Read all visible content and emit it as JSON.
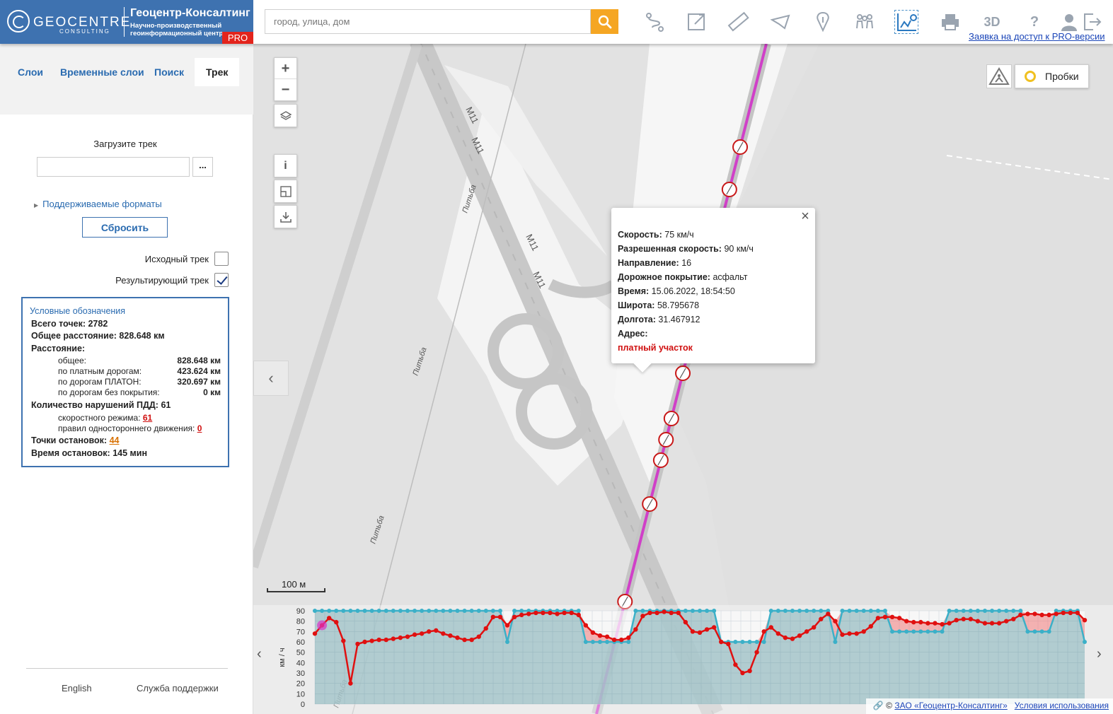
{
  "header": {
    "logo": {
      "brand": "GEOCENTRE",
      "brand_sub": "CONSULTING",
      "title_ru": "Геоцентр-Консалтинг",
      "subtitle_ru_1": "Научно-производственный",
      "subtitle_ru_2": "геоинформационный центр",
      "badge": "PRO"
    },
    "search": {
      "placeholder": "город, улица, дом",
      "value": ""
    },
    "toolbar": {
      "icons": [
        "route-icon",
        "export-icon",
        "ruler-icon",
        "area-icon",
        "info-pin-icon",
        "people-icon",
        "track-chart-icon",
        "print-icon",
        "3d-icon",
        "help-icon",
        "user-icon",
        "logout-icon"
      ],
      "label_3d": "3D",
      "label_help": "?"
    },
    "pro_link": "Заявка на доступ к PRO-версии"
  },
  "sidebar": {
    "tabs": [
      {
        "label": "Слои"
      },
      {
        "label": "Временные слои"
      },
      {
        "label": "Поиск"
      },
      {
        "label": "Трек"
      }
    ],
    "active_tab": "Трек",
    "upload": {
      "title": "Загрузите трек",
      "value": "",
      "browse_label": "..."
    },
    "formats_link": "Поддерживаемые форматы",
    "reset_button": "Сбросить",
    "checkboxes": [
      {
        "label": "Исходный трек",
        "checked": false
      },
      {
        "label": "Результирующий трек",
        "checked": true
      }
    ],
    "legend": {
      "title": "Условные обозначения",
      "total_points_label": "Всего точек:",
      "total_points": "2782",
      "total_distance_label": "Общее расстояние:",
      "total_distance": "828.648 км",
      "distance_label": "Расстояние:",
      "distances": [
        {
          "label": "общее:",
          "value": "828.648 км"
        },
        {
          "label": "по платным дорогам:",
          "value": "423.624 км"
        },
        {
          "label": "по дорогам ПЛАТОН:",
          "value": "320.697 км"
        },
        {
          "label": "по дорогам без покрытия:",
          "value": "0 км"
        }
      ],
      "violations_label": "Количество нарушений ПДД:",
      "violations": "61",
      "speed_violations_label": "скоростного режима:",
      "speed_violations": "61",
      "oneway_violations_label": "правил одностороннего движения:",
      "oneway_violations": "0",
      "stops_label": "Точки остановок:",
      "stops": "44",
      "stop_time_label": "Время остановок:",
      "stop_time": "145 мин"
    },
    "footer": {
      "language": "English",
      "support": "Служба поддержки"
    }
  },
  "map": {
    "controls": {
      "zoom_in": "+",
      "zoom_out": "−",
      "info": "i"
    },
    "traffic_button": "Пробки",
    "scale_label": "100 м",
    "road_labels": [
      "М11",
      "М11",
      "М11",
      "М11",
      "Питьба",
      "Питьба",
      "Питьба",
      "Питьба"
    ],
    "popup": {
      "rows": [
        {
          "label": "Скорость:",
          "value": "75 км/ч"
        },
        {
          "label": "Разрешенная скорость:",
          "value": "90 км/ч"
        },
        {
          "label": "Направление:",
          "value": "16"
        },
        {
          "label": "Дорожное покрытие:",
          "value": "асфальт"
        },
        {
          "label": "Время:",
          "value": "15.06.2022, 18:54:50"
        },
        {
          "label": "Широта:",
          "value": "58.795678"
        },
        {
          "label": "Долгота:",
          "value": "31.467912"
        },
        {
          "label": "Адрес:",
          "value": ""
        }
      ],
      "note": "платный участок"
    },
    "attribution": {
      "copyright": "©",
      "company_link": "ЗАО «Геоцентр-Консалтинг»",
      "terms_link": "Условия использования"
    },
    "colors": {
      "track": "#d040c8",
      "speed_line": "#e01010",
      "limit_line": "#3bb0c8",
      "accent": "#3e72b0",
      "search_button": "#f5a623",
      "pro_badge": "#e3241c"
    }
  },
  "chart_data": {
    "type": "line",
    "ylabel": "км / ч",
    "ylim": [
      0,
      90
    ],
    "yticks": [
      0,
      10,
      20,
      30,
      40,
      50,
      60,
      70,
      80,
      90
    ],
    "x": [
      0,
      1,
      2,
      3,
      4,
      5,
      6,
      7,
      8,
      9,
      10,
      11,
      12,
      13,
      14,
      15,
      16,
      17,
      18,
      19,
      20,
      21,
      22,
      23,
      24,
      25,
      26,
      27,
      28,
      29,
      30,
      31,
      32,
      33,
      34,
      35,
      36,
      37,
      38,
      39,
      40,
      41,
      42,
      43,
      44,
      45,
      46,
      47,
      48,
      49,
      50,
      51,
      52,
      53,
      54,
      55,
      56,
      57,
      58,
      59,
      60,
      61,
      62,
      63,
      64,
      65,
      66,
      67,
      68,
      69,
      70,
      71,
      72,
      73,
      74,
      75,
      76,
      77,
      78,
      79,
      80,
      81,
      82,
      83,
      84,
      85,
      86,
      87,
      88,
      89,
      90,
      91,
      92,
      93,
      94,
      95,
      96,
      97,
      98,
      99,
      100,
      101,
      102,
      103,
      104,
      105,
      106,
      107,
      108
    ],
    "series": [
      {
        "values": [
          68,
          76,
          83,
          79,
          61,
          20,
          58,
          60,
          61,
          62,
          62,
          63,
          64,
          65,
          67,
          68,
          70,
          71,
          68,
          66,
          64,
          62,
          62,
          65,
          73,
          84,
          84,
          76,
          84,
          86,
          87,
          88,
          88,
          88,
          87,
          88,
          88,
          86,
          76,
          69,
          66,
          65,
          62,
          62,
          64,
          72,
          85,
          88,
          88,
          89,
          88,
          88,
          79,
          70,
          69,
          72,
          74,
          60,
          58,
          38,
          30,
          32,
          50,
          70,
          74,
          68,
          64,
          63,
          66,
          70,
          74,
          82,
          87,
          80,
          67,
          68,
          68,
          70,
          75,
          83,
          84,
          84,
          83,
          80,
          79,
          79,
          78,
          78,
          77,
          78,
          81,
          82,
          82,
          80,
          78,
          78,
          78,
          80,
          82,
          86,
          87,
          87,
          86,
          86,
          87,
          88,
          88,
          88,
          81
        ]
      },
      {
        "values": [
          90,
          90,
          90,
          90,
          90,
          90,
          90,
          90,
          90,
          90,
          90,
          90,
          90,
          90,
          90,
          90,
          90,
          90,
          90,
          90,
          90,
          90,
          90,
          90,
          90,
          90,
          90,
          60,
          90,
          90,
          90,
          90,
          90,
          90,
          90,
          90,
          90,
          90,
          60,
          60,
          60,
          60,
          60,
          60,
          60,
          90,
          90,
          90,
          90,
          90,
          90,
          90,
          90,
          90,
          90,
          90,
          90,
          60,
          60,
          60,
          60,
          60,
          60,
          60,
          90,
          90,
          90,
          90,
          90,
          90,
          90,
          90,
          90,
          60,
          90,
          90,
          90,
          90,
          90,
          90,
          90,
          70,
          70,
          70,
          70,
          70,
          70,
          70,
          70,
          90,
          90,
          90,
          90,
          90,
          90,
          90,
          90,
          90,
          90,
          90,
          70,
          70,
          70,
          70,
          90,
          90,
          90,
          90,
          60
        ]
      }
    ]
  }
}
